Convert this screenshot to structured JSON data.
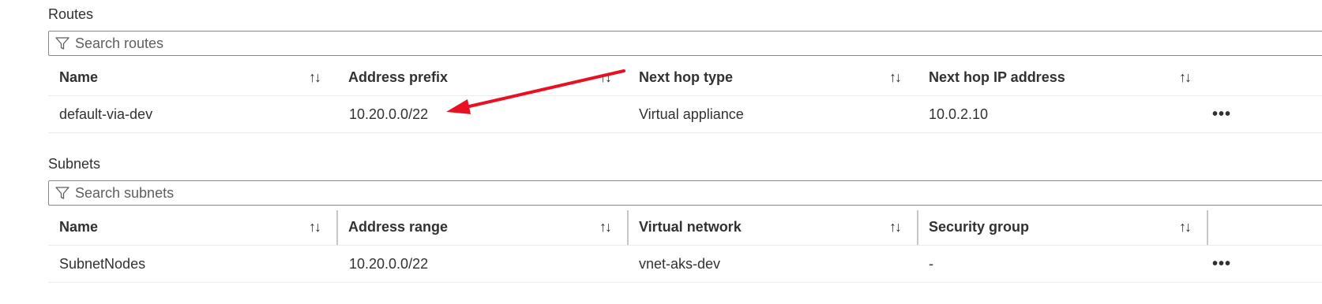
{
  "routes": {
    "title": "Routes",
    "search_placeholder": "Search routes",
    "columns": [
      "Name",
      "Address prefix",
      "Next hop type",
      "Next hop IP address"
    ],
    "rows": [
      {
        "name": "default-via-dev",
        "address_prefix": "10.20.0.0/22",
        "next_hop_type": "Virtual appliance",
        "next_hop_ip": "10.0.2.10"
      }
    ]
  },
  "subnets": {
    "title": "Subnets",
    "search_placeholder": "Search subnets",
    "columns": [
      "Name",
      "Address range",
      "Virtual network",
      "Security group"
    ],
    "rows": [
      {
        "name": "SubnetNodes",
        "address_range": "10.20.0.0/22",
        "virtual_network": "vnet-aks-dev",
        "security_group": "-"
      }
    ]
  },
  "icons": {
    "sort": "sort-arrows-icon",
    "more": "more-options-icon",
    "filter": "filter-icon"
  },
  "sort_glyph": "↑↓",
  "more_glyph": "•••",
  "annotation": {
    "color": "#e81123"
  }
}
